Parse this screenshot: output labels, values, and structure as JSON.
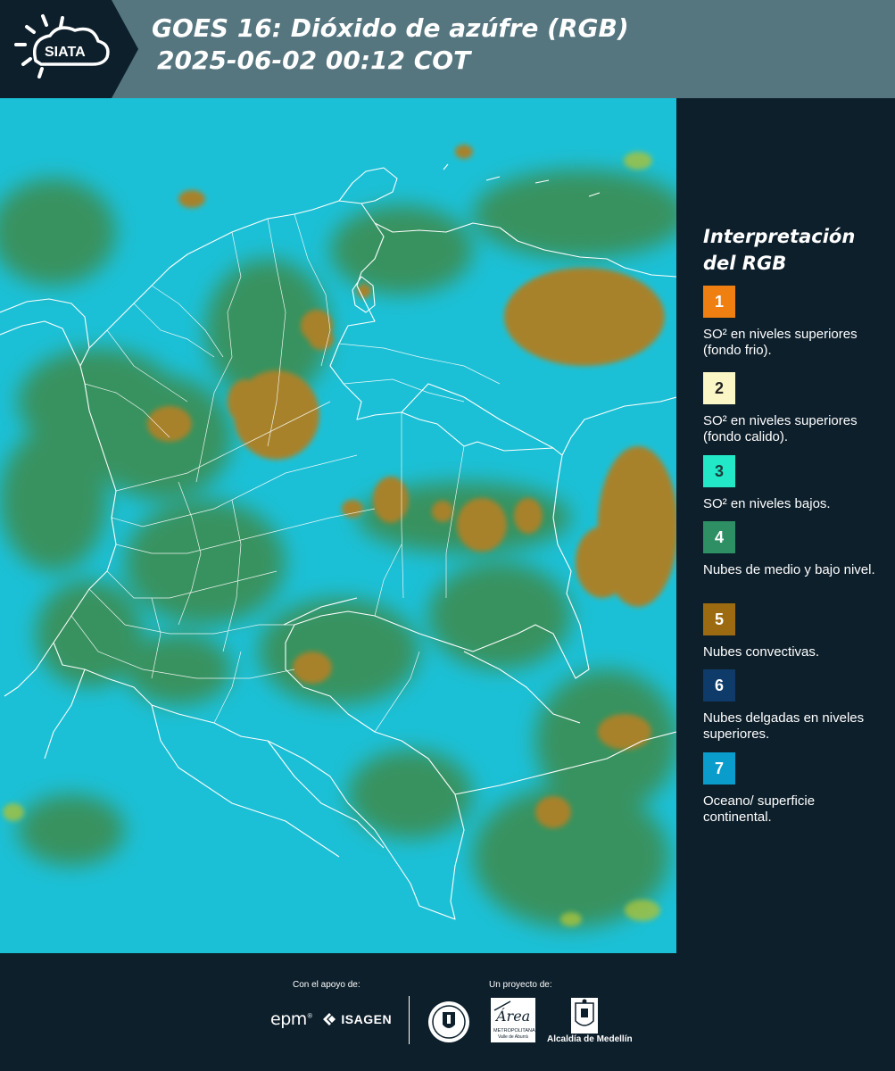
{
  "header": {
    "logo_text": "SIATA",
    "title_line1": "GOES 16: Dióxido de azúfre (RGB)",
    "title_line2": "2025-06-02 00:12 COT",
    "colors": {
      "header_bg": "#55757f",
      "logo_bg": "#0d1f2b"
    }
  },
  "map": {
    "description_icons": [
      "satellite-rgb-image",
      "country-borders",
      "department-borders"
    ],
    "colors": {
      "ocean_surface": "#1cc0d6",
      "mid_low_clouds": "#3c8a4c",
      "convective": "#a7822a",
      "borders": "#ffffff"
    }
  },
  "legend": {
    "title_line1": "Interpretación",
    "title_line2": "del RGB",
    "items": [
      {
        "number": "1",
        "label": "SO² en niveles superiores (fondo frio).",
        "color": "#f07f12",
        "text_color": "#ffffff"
      },
      {
        "number": "2",
        "label": "SO² en niveles superiores (fondo calido).",
        "color": "#fbf6c6",
        "text_color": "#222222"
      },
      {
        "number": "3",
        "label": "SO² en niveles bajos.",
        "color": "#22e8c8",
        "text_color": "#1b3a3a"
      },
      {
        "number": "4",
        "label": "Nubes de medio y bajo nivel.",
        "color": "#2f8f64",
        "text_color": "#ffffff"
      },
      {
        "number": "5",
        "label": "Nubes convectivas.",
        "color": "#9c6a10",
        "text_color": "#ffffff"
      },
      {
        "number": "6",
        "label": "Nubes delgadas en niveles superiores.",
        "color": "#0e3b6a",
        "text_color": "#ffffff"
      },
      {
        "number": "7",
        "label": "Oceano/ superficie continental.",
        "color": "#0a9ccb",
        "text_color": "#ffffff"
      }
    ]
  },
  "footer": {
    "support_label": "Con el apoyo de:",
    "project_label": "Un proyecto de:",
    "epm_logo": "epm",
    "isagen_logo": "ISAGEN",
    "area_logo_text": "Área",
    "area_logo_sub": "METROPOLITANA",
    "area_logo_sub2": "Valle de Aburrá",
    "alcaldia_label": "Alcaldía de Medellín"
  }
}
